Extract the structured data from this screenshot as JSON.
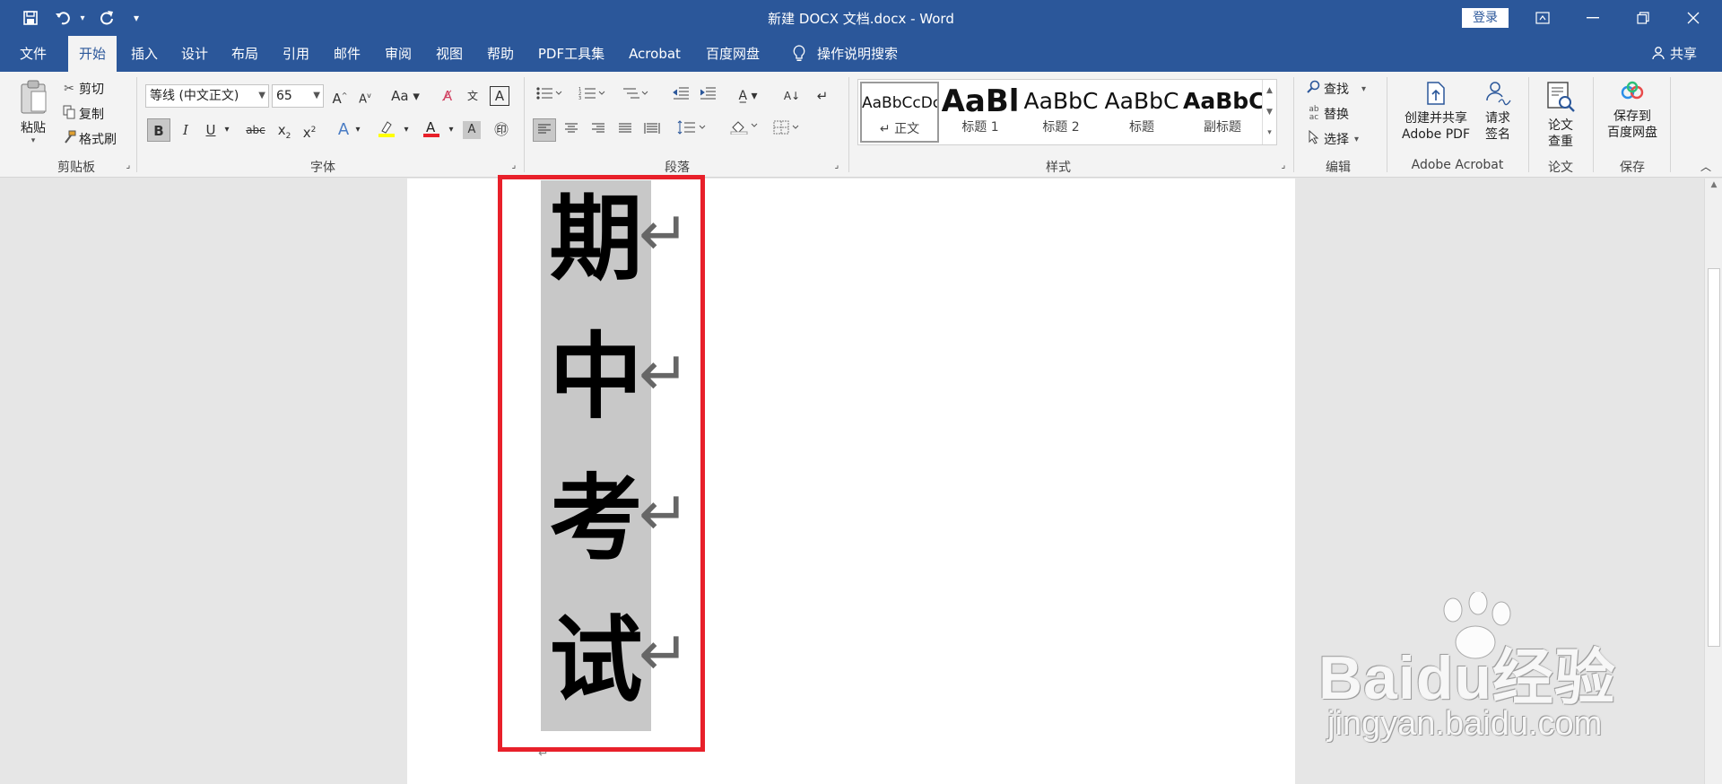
{
  "window": {
    "title": "新建 DOCX 文档.docx  -  Word",
    "login_label": "登录",
    "share_label": "共享"
  },
  "quick_access": [
    "save-icon",
    "undo-icon",
    "redo-icon",
    "customize-icon"
  ],
  "tabs": [
    {
      "label": "文件"
    },
    {
      "label": "开始",
      "active": true
    },
    {
      "label": "插入"
    },
    {
      "label": "设计"
    },
    {
      "label": "布局"
    },
    {
      "label": "引用"
    },
    {
      "label": "邮件"
    },
    {
      "label": "审阅"
    },
    {
      "label": "视图"
    },
    {
      "label": "帮助"
    },
    {
      "label": "PDF工具集"
    },
    {
      "label": "Acrobat"
    },
    {
      "label": "百度网盘"
    },
    {
      "label": "操作说明搜索"
    }
  ],
  "ribbon": {
    "clipboard": {
      "paste": "粘贴",
      "cut": "剪切",
      "copy": "复制",
      "format_painter": "格式刷",
      "group": "剪贴板"
    },
    "font": {
      "name": "等线 (中文正文)",
      "size": "65",
      "group": "字体"
    },
    "paragraph": {
      "group": "段落"
    },
    "styles": {
      "group": "样式",
      "items": [
        {
          "sample": "AaBbCcDc",
          "name": "↵ 正文",
          "selected": true
        },
        {
          "sample": "AaBl",
          "name": "标题 1"
        },
        {
          "sample": "AaBbC",
          "name": "标题 2"
        },
        {
          "sample": "AaBbC",
          "name": "标题"
        },
        {
          "sample": "AaBbC",
          "name": "副标题"
        }
      ]
    },
    "editing": {
      "find": "查找",
      "replace": "替换",
      "select": "选择",
      "group": "编辑"
    },
    "acrobat": {
      "create_line1": "创建并共享",
      "create_line2": "Adobe PDF",
      "sign_line1": "请求",
      "sign_line2": "签名",
      "group": "Adobe Acrobat"
    },
    "paper": {
      "line1": "论文",
      "line2": "查重",
      "group": "论文"
    },
    "save": {
      "line1": "保存到",
      "line2": "百度网盘",
      "group": "保存"
    }
  },
  "document": {
    "characters": [
      "期",
      "中",
      "考",
      "试"
    ],
    "paragraph_mark": "↵"
  },
  "watermark": {
    "main": "Baidu经验",
    "url": "jingyan.baidu.com"
  },
  "colors": {
    "brand": "#2b579a",
    "highlight": "#c8c8c8",
    "annotation": "#e8202a"
  }
}
